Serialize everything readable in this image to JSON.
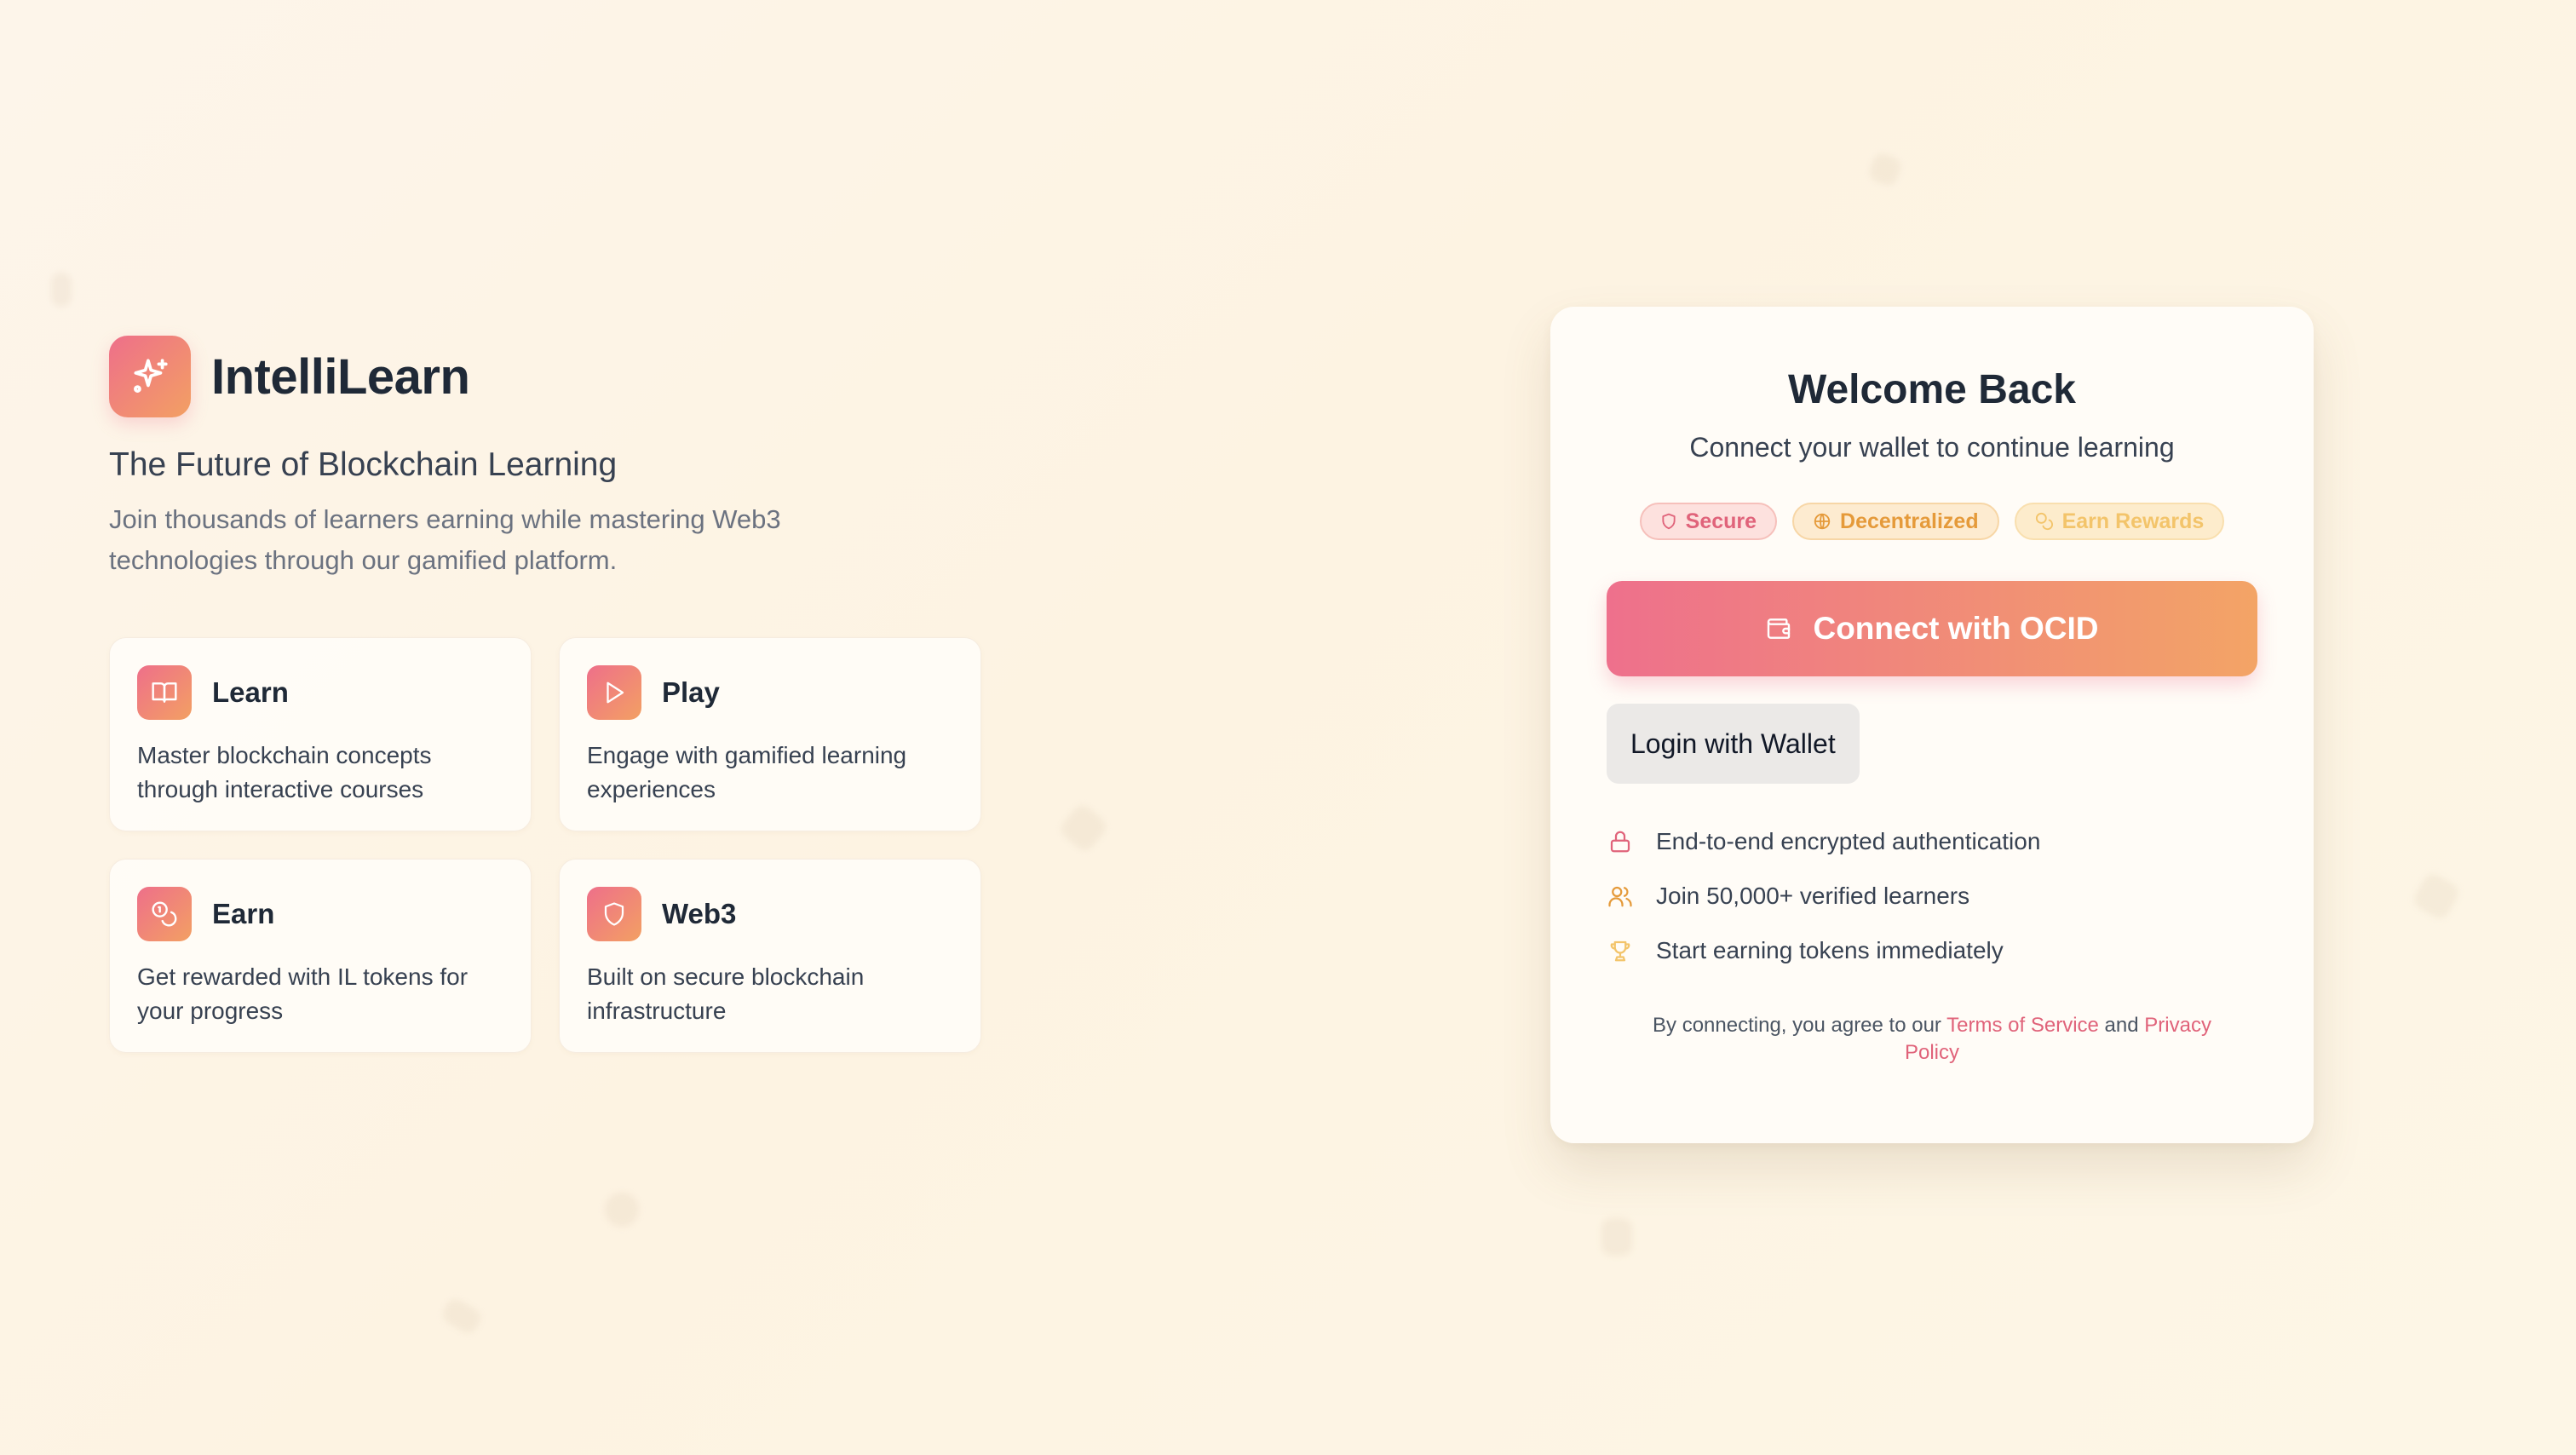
{
  "brand": {
    "name": "IntelliLearn",
    "logo_icon": "sparkles-icon",
    "tagline": "The Future of Blockchain Learning",
    "intro": "Join thousands of learners earning while mastering Web3 technologies through our gamified platform."
  },
  "features": [
    {
      "icon": "book-open-icon",
      "title": "Learn",
      "description": "Master blockchain concepts through interactive courses"
    },
    {
      "icon": "play-icon",
      "title": "Play",
      "description": "Engage with gamified learning experiences"
    },
    {
      "icon": "coins-icon",
      "title": "Earn",
      "description": "Get rewarded with IL tokens for your progress"
    },
    {
      "icon": "shield-icon",
      "title": "Web3",
      "description": "Built on secure blockchain infrastructure"
    }
  ],
  "login": {
    "title": "Welcome Back",
    "subtitle": "Connect your wallet to continue learning",
    "badges": [
      {
        "icon": "shield-icon",
        "label": "Secure",
        "color": "#e0637a"
      },
      {
        "icon": "globe-icon",
        "label": "Decentralized",
        "color": "#e59a3a"
      },
      {
        "icon": "coins-icon",
        "label": "Earn Rewards",
        "color": "#f3c46a"
      }
    ],
    "primary_button": {
      "icon": "wallet-icon",
      "label": "Connect with OCID"
    },
    "secondary_button": {
      "label": "Login with Wallet"
    },
    "perks": [
      {
        "icon": "lock-icon",
        "text": "End-to-end encrypted authentication",
        "color": "#e0637a"
      },
      {
        "icon": "users-icon",
        "text": "Join 50,000+ verified learners",
        "color": "#e59a3a"
      },
      {
        "icon": "trophy-icon",
        "text": "Start earning tokens immediately",
        "color": "#f3c46a"
      }
    ],
    "legal": {
      "prefix": "By connecting, you agree to our",
      "terms_link": "Terms of Service",
      "and": "and",
      "privacy_link": "Privacy Policy"
    }
  },
  "colors": {
    "accent_pink": "#ee708c",
    "accent_orange": "#f3a466",
    "background": "#fdf4e6"
  }
}
